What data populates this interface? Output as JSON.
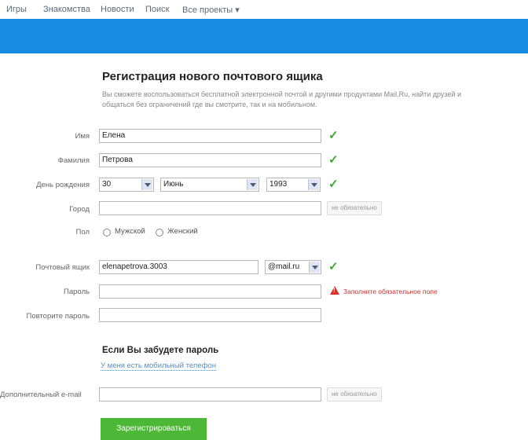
{
  "topnav": {
    "items": [
      "Игры",
      "Знакомства",
      "Новости",
      "Поиск"
    ],
    "all_projects": "Все проекты ▾"
  },
  "form": {
    "title": "Регистрация нового почтового ящика",
    "description": "Вы сможете воспользоваться бесплатной электронной почтой и другими продуктами Mail.Ru, найти друзей и общаться без ограничений где вы смотрите, так и на мобильном.",
    "labels": {
      "first_name": "Имя",
      "last_name": "Фамилия",
      "birthday": "День рождения",
      "city": "Город",
      "gender": "Пол",
      "email": "Почтовый ящик",
      "password": "Пароль",
      "password_repeat": "Повторите пароль",
      "extra_email": "Дополнительный e-mail"
    },
    "values": {
      "first_name": "Елена",
      "last_name": "Петрова",
      "birth_day": "30",
      "birth_month": "Июнь",
      "birth_year": "1993",
      "city": "",
      "email_login": "elenapetrova.3003",
      "email_domain": "@mail.ru",
      "password": "",
      "password_repeat": "",
      "extra_email": ""
    },
    "gender_options": [
      "Мужской",
      "Женский"
    ],
    "optional_hint": "не обязательно",
    "password_error": "Заполните обязательное поле",
    "forgot_title": "Если Вы забудете пароль",
    "phone_link": "У меня есть мобильный телефон",
    "submit_label": "Зарегистрироваться"
  },
  "colors": {
    "banner": "#168de2",
    "check": "#3aa832",
    "error": "#d6332a",
    "submit": "#4db838",
    "link": "#5a8fc2"
  },
  "icons": {
    "valid": "check-icon",
    "error": "warning-triangle-icon",
    "dropdown": "chevron-down-icon"
  }
}
